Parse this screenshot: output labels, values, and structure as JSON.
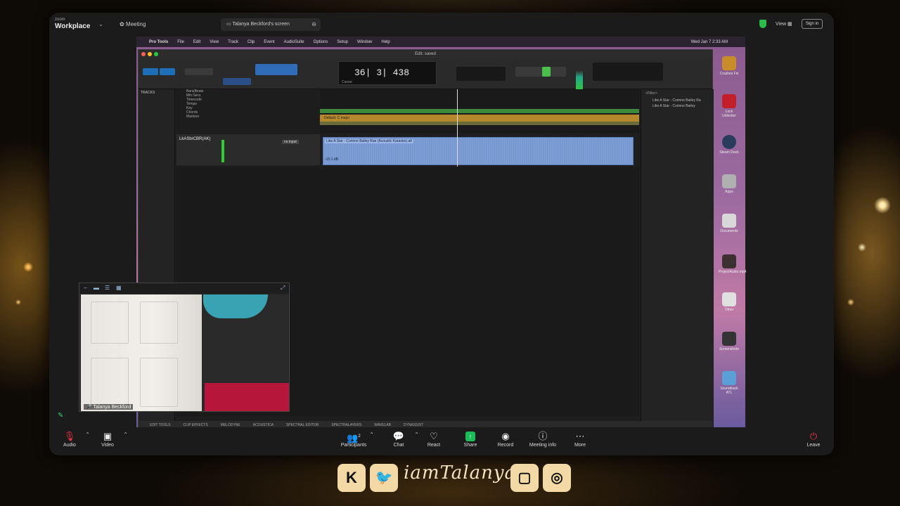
{
  "zoom": {
    "logo_small": "zoom",
    "logo": "Workplace",
    "meeting_label": "Meeting",
    "share_tab": "Talanya Beckford's screen",
    "view_label": "View",
    "signin_label": "Sign in"
  },
  "mac_menubar": {
    "app": "Pro Tools",
    "items": [
      "File",
      "Edit",
      "View",
      "Track",
      "Clip",
      "Event",
      "AudioSuite",
      "Options",
      "Setup",
      "Window",
      "Help"
    ],
    "datetime": "Wed Jan 7  2:33 AM"
  },
  "protools": {
    "window_title": "Edit: saved",
    "counter_main": "36| 3| 438",
    "counter_label": "Cursor",
    "tracks_header": "TRACKS",
    "rulers": [
      "Bars|Beats",
      "Min:Secs",
      "Timecode",
      "Tempo",
      "Key",
      "Chords",
      "Markers"
    ],
    "ruler_key_label": "Default: C major",
    "track_name": "LkASbrCBR(AK)",
    "track_io": "no input",
    "clip_name": "Like A Star - Corinne Bailey Rae (Acoustic Karaoke).aif",
    "clip_volume": "-15.1 dB",
    "clips_filter": "<Filter>",
    "clip_list": [
      "Like A Star - Corinne Bailey Ra",
      "Like A Star - Corinne Bailey"
    ],
    "bottom_tabs": [
      "EDIT TOOLS",
      "CLIP EFFECTS",
      "MELODYNE",
      "ACOUSTICA",
      "SPECTRAL EDITOR",
      "SPECTRALAYERS",
      "WAVELAB",
      "DYNASSIST"
    ]
  },
  "dock": [
    {
      "label": "Crashes Fix",
      "color": "#c98c2a"
    },
    {
      "label": "Lock Unlocker",
      "color": "#c21f2b"
    },
    {
      "label": "Steam Dock",
      "color": "#2a3c5c"
    },
    {
      "label": "Apps",
      "color": "#b0b0b0"
    },
    {
      "label": "Documents",
      "color": "#d8d8d8"
    },
    {
      "label": "ProjectAudio.mp4",
      "color": "#3c3030"
    },
    {
      "label": "Other",
      "color": "#e0e0e0"
    },
    {
      "label": "Screenshots",
      "color": "#333"
    },
    {
      "label": "Soundtrack ATL",
      "color": "#5aa0d6"
    }
  ],
  "self_view": {
    "name": "Talanya Beckford"
  },
  "controls": {
    "audio": "Audio",
    "video": "Video",
    "participants": "Participants",
    "participants_count": "2",
    "chat": "Chat",
    "react": "React",
    "share": "Share",
    "record": "Record",
    "meeting_info": "Meeting info",
    "more": "More",
    "leave": "Leave"
  },
  "socials": {
    "handle": "iamTalanya",
    "kick": "K"
  },
  "colors": {
    "share_green": "#1dbb5a",
    "track_clip_blue": "#7d9ed6",
    "gold": "#f2d9a6"
  }
}
